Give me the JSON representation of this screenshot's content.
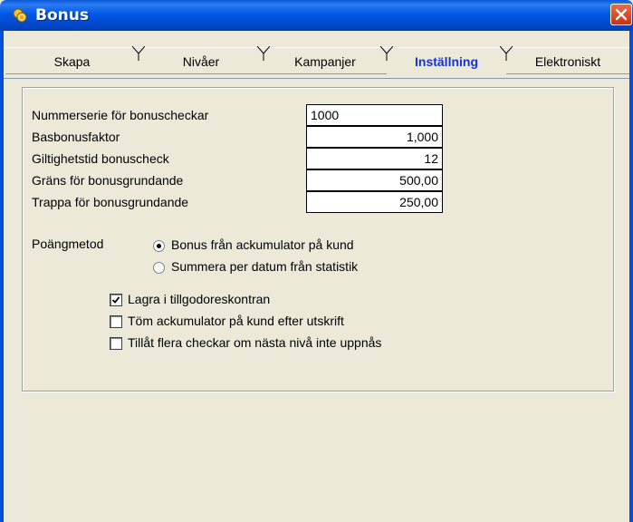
{
  "window": {
    "title": "Bonus",
    "icon": "bonus-coins-icon",
    "close_icon": "close-icon"
  },
  "tabs": [
    {
      "label": "Skapa",
      "active": false
    },
    {
      "label": "Nivåer",
      "active": false
    },
    {
      "label": "Kampanjer",
      "active": false
    },
    {
      "label": "Inställning",
      "active": true
    },
    {
      "label": "Elektroniskt",
      "active": false
    }
  ],
  "settings": {
    "fields": [
      {
        "label": "Nummerserie för bonuscheckar",
        "value": "1000"
      },
      {
        "label": "Basbonusfaktor",
        "value": "1,000"
      },
      {
        "label": "Giltighetstid bonuscheck",
        "value": "12"
      },
      {
        "label": "Gräns för bonusgrundande",
        "value": "500,00"
      },
      {
        "label": "Trappa för bonusgrundande",
        "value": "250,00"
      }
    ],
    "point_method": {
      "label": "Poängmetod",
      "options": [
        {
          "label": "Bonus från ackumulator på kund",
          "selected": true
        },
        {
          "label": "Summera per datum från statistik",
          "selected": false
        }
      ]
    },
    "checkboxes": [
      {
        "label": "Lagra i tillgodoreskontran",
        "checked": true
      },
      {
        "label": "Töm ackumulator på kund efter utskrift",
        "checked": false
      },
      {
        "label": "Tillåt flera checkar om nästa nivå inte uppnås",
        "checked": false
      }
    ]
  },
  "colors": {
    "titlebar": "#0058e6",
    "active_tab_text": "#1633cf",
    "face": "#ece9d8",
    "close": "#c7320f"
  }
}
